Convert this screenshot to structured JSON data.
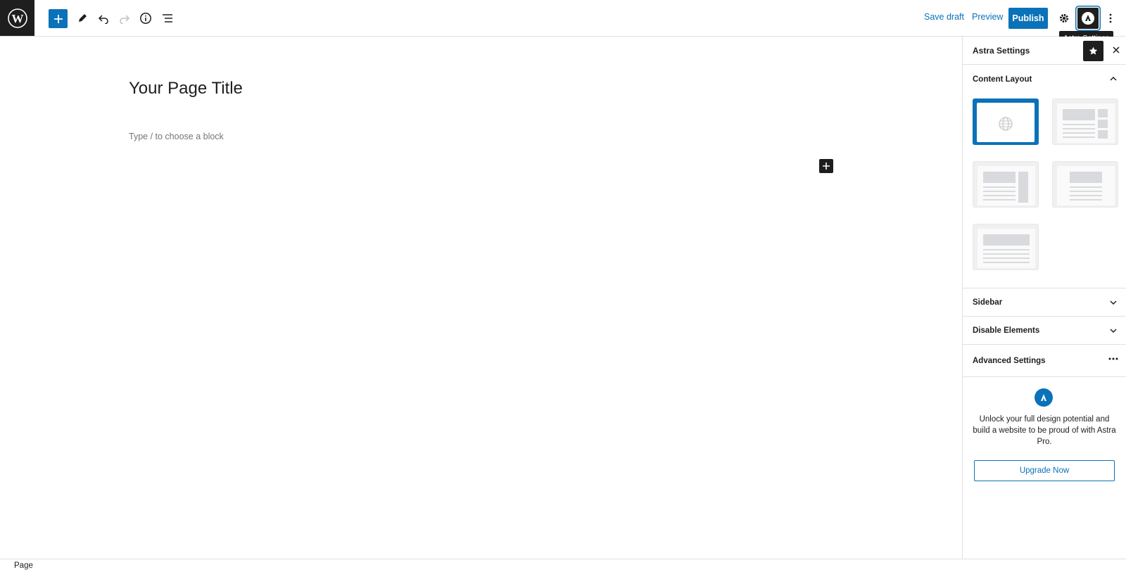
{
  "toolbar": {
    "logo_icon": "wordpress-icon",
    "inserter_icon": "plus-icon",
    "tools_icon": "pencil-icon",
    "undo_icon": "undo-icon",
    "redo_icon": "redo-icon",
    "info_icon": "info-icon",
    "list_view_icon": "list-view-icon",
    "save_draft": "Save draft",
    "preview": "Preview",
    "publish": "Publish",
    "settings_icon": "gear-icon",
    "astra_icon": "astra-icon",
    "options_icon": "kebab-icon",
    "tooltip": "Astra Settings",
    "accent_color": "#0a72b8"
  },
  "editor": {
    "title": "Your Page Title",
    "placeholder": "Type / to choose a block"
  },
  "sidebar": {
    "title": "Astra Settings",
    "panels": [
      {
        "label": "Content Layout",
        "state": "open"
      },
      {
        "label": "Sidebar",
        "state": "collapsed"
      },
      {
        "label": "Disable Elements",
        "state": "collapsed"
      },
      {
        "label": "Advanced Settings",
        "state": "menu"
      }
    ],
    "layout_options": [
      {
        "name": "default",
        "selected": true
      },
      {
        "name": "right-sidebar",
        "selected": false
      },
      {
        "name": "boxed-sidebar",
        "selected": false
      },
      {
        "name": "narrow",
        "selected": false
      },
      {
        "name": "full-width",
        "selected": false
      }
    ],
    "upsell_text": "Unlock your full design potential and build a website to be proud of with Astra Pro.",
    "upgrade_button": "Upgrade Now"
  },
  "footer": {
    "breadcrumb": "Page"
  }
}
